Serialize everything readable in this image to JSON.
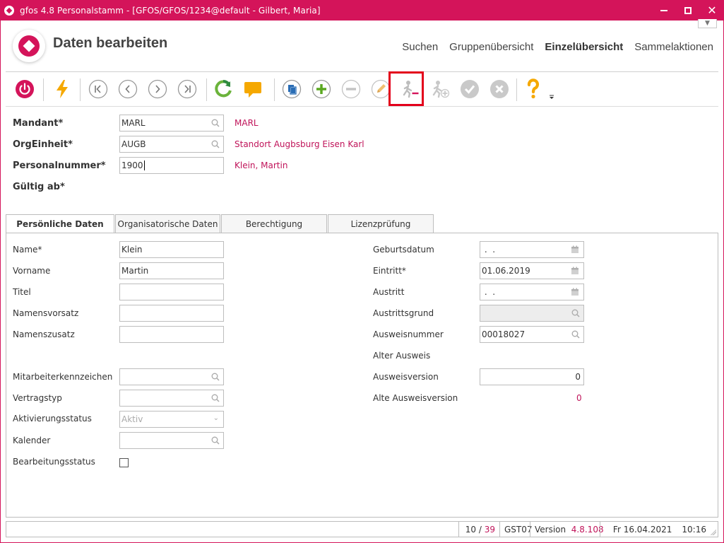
{
  "window": {
    "title": "gfos 4.8  Personalstamm - [GFOS/GFOS/1234@default - Gilbert, Maria]",
    "brand_color": "#d4145a"
  },
  "header": {
    "page_title": "Daten bearbeiten",
    "nav": [
      {
        "label": "Suchen",
        "active": false
      },
      {
        "label": "Gruppenübersicht",
        "active": false
      },
      {
        "label": "Einzelübersicht",
        "active": true
      },
      {
        "label": "Sammelaktionen",
        "active": false
      }
    ]
  },
  "toolbar": {
    "buttons": [
      {
        "name": "power-icon"
      },
      {
        "name": "lightning-icon"
      },
      {
        "name": "first-record-icon"
      },
      {
        "name": "previous-record-icon"
      },
      {
        "name": "next-record-icon"
      },
      {
        "name": "last-record-icon"
      },
      {
        "name": "refresh-icon"
      },
      {
        "name": "comment-icon"
      },
      {
        "name": "copy-icon"
      },
      {
        "name": "add-icon"
      },
      {
        "name": "remove-icon"
      },
      {
        "name": "edit-icon"
      },
      {
        "name": "person-leave-icon",
        "highlighted": true
      },
      {
        "name": "person-add-icon"
      },
      {
        "name": "confirm-icon"
      },
      {
        "name": "cancel-icon"
      },
      {
        "name": "help-icon"
      },
      {
        "name": "more-icon"
      }
    ]
  },
  "header_form": {
    "mandant": {
      "label": "Mandant*",
      "value": "MARL",
      "ref": "MARL"
    },
    "orgeinheit": {
      "label": "OrgEinheit*",
      "value": "AUGB",
      "ref": "Standort Augbsburg Eisen Karl"
    },
    "personalnummer": {
      "label": "Personalnummer*",
      "value": "1900",
      "ref": "Klein, Martin"
    },
    "gueltig_ab": {
      "label": "Gültig ab*"
    }
  },
  "tabs": [
    {
      "label": "Persönliche Daten",
      "active": true
    },
    {
      "label": "Organisatorische Daten",
      "active": false
    },
    {
      "label": "Berechtigung",
      "active": false
    },
    {
      "label": "Lizenzprüfung",
      "active": false
    }
  ],
  "personal": {
    "left": {
      "name": {
        "label": "Name*",
        "value": "Klein"
      },
      "vorname": {
        "label": "Vorname",
        "value": "Martin"
      },
      "titel": {
        "label": "Titel",
        "value": ""
      },
      "namensvorsatz": {
        "label": "Namensvorsatz",
        "value": ""
      },
      "namenszusatz": {
        "label": "Namenszusatz",
        "value": ""
      },
      "mitarbeiterkennzeichen": {
        "label": "Mitarbeiterkennzeichen",
        "value": ""
      },
      "vertragstyp": {
        "label": "Vertragstyp",
        "value": ""
      },
      "aktivierungsstatus": {
        "label": "Aktivierungsstatus",
        "value": "Aktiv"
      },
      "kalender": {
        "label": "Kalender",
        "value": ""
      },
      "bearbeitungsstatus": {
        "label": "Bearbeitungsstatus",
        "checked": false
      }
    },
    "right": {
      "geburtsdatum": {
        "label": "Geburtsdatum",
        "value": " .  ."
      },
      "eintritt": {
        "label": "Eintritt*",
        "value": "01.06.2019"
      },
      "austritt": {
        "label": "Austritt",
        "value": " .  ."
      },
      "austrittsgrund": {
        "label": "Austrittsgrund",
        "value": ""
      },
      "ausweisnummer": {
        "label": "Ausweisnummer",
        "value": "00018027"
      },
      "alter_ausweis": {
        "label": "Alter Ausweis"
      },
      "ausweisversion": {
        "label": "Ausweisversion",
        "value": "0"
      },
      "alte_ausweisversion": {
        "label": "Alte Ausweisversion",
        "value": "0"
      }
    }
  },
  "status": {
    "record_current": "10",
    "record_sep": "/",
    "record_total": "39",
    "code": "GST07",
    "version_label": "Version",
    "version_value": "4.8.108",
    "date": "Fr 16.04.2021",
    "time": "10:16"
  }
}
